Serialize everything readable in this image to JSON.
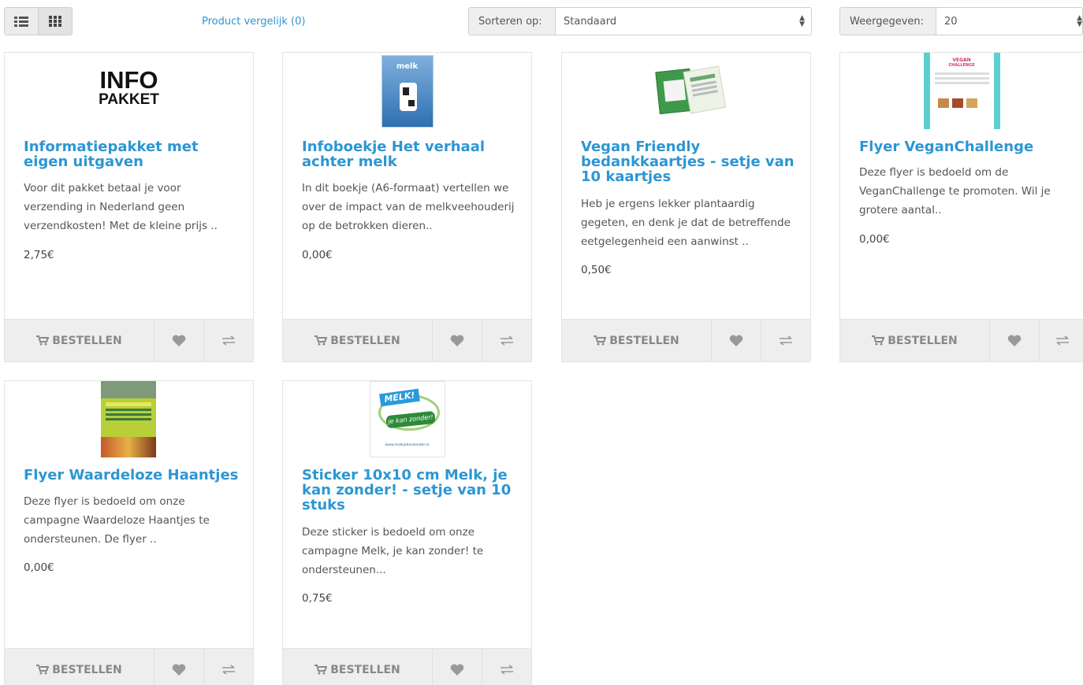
{
  "toolbar": {
    "compare_link": "Product vergelijk (0)",
    "sort_label": "Sorteren op:",
    "sort_value": "Standaard",
    "show_label": "Weergegeven:",
    "show_value": "20"
  },
  "icons": {
    "list_view": "list-view-icon",
    "grid_view": "grid-view-icon",
    "cart": "cart-icon",
    "wishlist": "heart-icon",
    "compare": "compare-arrows-icon"
  },
  "colors": {
    "link": "#2d96d3",
    "action_bar": "#eeeeee",
    "action_icon": "#999999"
  },
  "order_label": "BESTELLEN",
  "products": [
    {
      "title": "Informatiepakket met eigen uitgaven",
      "description": "Voor dit pakket betaal je voor verzending in Nederland geen verzendkosten! Met de kleine prijs ..",
      "price": "2,75€",
      "image_text": {
        "line1": "INFO",
        "line2": "PAKKET"
      }
    },
    {
      "title": "Infoboekje Het verhaal achter melk",
      "description": "In dit boekje (A6-formaat) vertellen we over de impact van de melkveehouderij op de betrokken dieren..",
      "price": "0,00€",
      "image_text": {
        "line1": "melk"
      }
    },
    {
      "title": "Vegan Friendly bedankkaartjes - setje van 10 kaartjes",
      "description": "Heb je ergens lekker plantaardig gegeten, en denk je dat de betreffende eetgelegenheid een aanwinst ..",
      "price": "0,50€"
    },
    {
      "title": "Flyer VeganChallenge",
      "description": "Deze flyer is bedoeld om de VeganChallenge te promoten. Wil je grotere aantal..",
      "price": "0,00€",
      "image_text": {
        "line1": "VEGAN",
        "line2": "CHALLENGE"
      }
    },
    {
      "title": "Flyer Waardeloze Haantjes",
      "description": "Deze flyer is bedoeld om onze campagne Waardeloze Haantjes te ondersteunen. De flyer ..",
      "price": "0,00€"
    },
    {
      "title": "Sticker 10x10 cm Melk, je kan zonder! - setje van 10 stuks",
      "description": "Deze sticker is bedoeld om onze campagne Melk, je kan zonder! te ondersteunen...",
      "price": "0,75€",
      "image_text": {
        "line1": "MELK!",
        "line2": "je kan zonder!",
        "line3": "www.melkjekanzonder.nl"
      }
    }
  ]
}
